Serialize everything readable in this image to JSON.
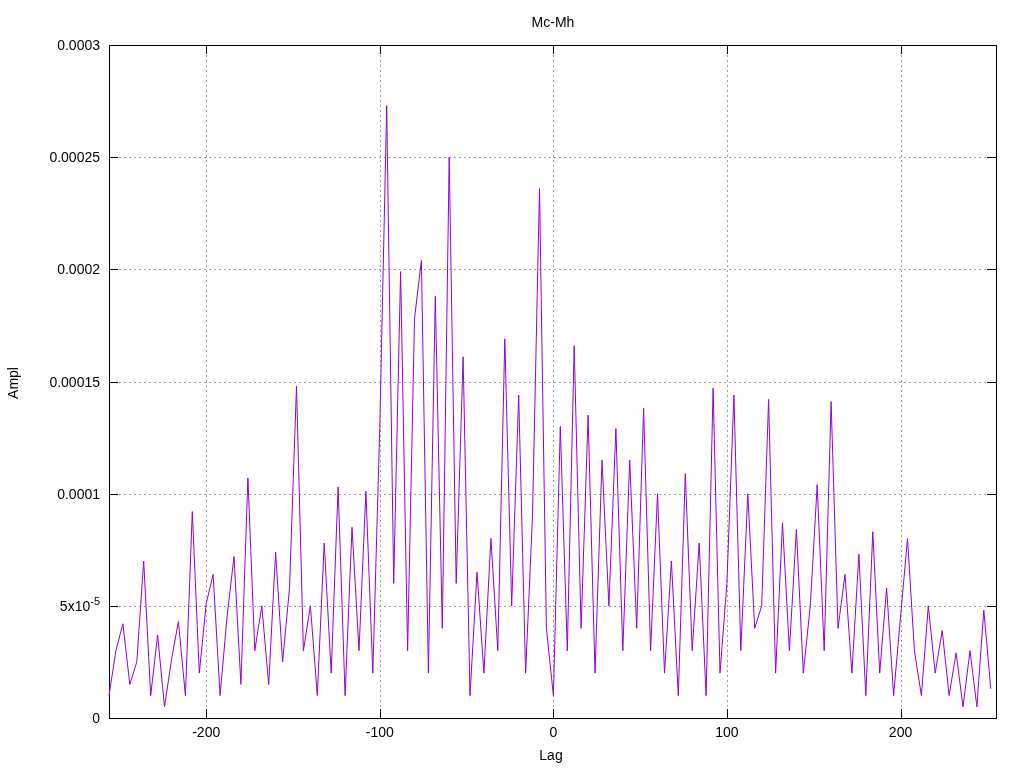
{
  "chart_data": {
    "type": "line",
    "grid": true,
    "title": "Mc-Mh",
    "xlabel": "Lag",
    "ylabel": "Ampl",
    "xlim": [
      -256,
      255
    ],
    "ylim": [
      0,
      0.0003
    ],
    "xticks": [
      -200,
      -100,
      0,
      100,
      200
    ],
    "yticks": [
      {
        "value": 0,
        "label": "0"
      },
      {
        "value": 5e-05,
        "label": "5x10$^{-5}$"
      },
      {
        "value": 0.0001,
        "label": "0.0001"
      },
      {
        "value": 0.00015,
        "label": "0.00015"
      },
      {
        "value": 0.0002,
        "label": "0.0002"
      },
      {
        "value": 0.00025,
        "label": "0.00025"
      },
      {
        "value": 0.0003,
        "label": "0.0003"
      }
    ],
    "x": [
      -256,
      -252,
      -248,
      -244,
      -240,
      -236,
      -232,
      -228,
      -224,
      -220,
      -216,
      -212,
      -208,
      -204,
      -200,
      -196,
      -192,
      -188,
      -184,
      -180,
      -176,
      -172,
      -168,
      -164,
      -160,
      -156,
      -152,
      -148,
      -144,
      -140,
      -136,
      -132,
      -128,
      -124,
      -120,
      -116,
      -112,
      -108,
      -104,
      -100,
      -96,
      -92,
      -88,
      -84,
      -80,
      -76,
      -72,
      -68,
      -64,
      -60,
      -56,
      -52,
      -48,
      -44,
      -40,
      -36,
      -32,
      -28,
      -24,
      -20,
      -16,
      -12,
      -8,
      -4,
      0,
      4,
      8,
      12,
      16,
      20,
      24,
      28,
      32,
      36,
      40,
      44,
      48,
      52,
      56,
      60,
      64,
      68,
      72,
      76,
      80,
      84,
      88,
      92,
      96,
      100,
      104,
      108,
      112,
      116,
      120,
      124,
      128,
      132,
      136,
      140,
      144,
      148,
      152,
      156,
      160,
      164,
      168,
      172,
      176,
      180,
      184,
      188,
      192,
      196,
      200,
      204,
      208,
      212,
      216,
      220,
      224,
      228,
      232,
      236,
      240,
      244,
      248,
      252
    ],
    "series": [
      {
        "color": "#9400d3",
        "values": [
          1e-05,
          3e-05,
          4.2e-05,
          1.5e-05,
          2.5e-05,
          7e-05,
          1e-05,
          3.7e-05,
          5e-06,
          2.6e-05,
          4.3e-05,
          1e-05,
          9.2e-05,
          2e-05,
          5.1e-05,
          6.4e-05,
          1e-05,
          4.5e-05,
          7.2e-05,
          1.5e-05,
          0.000107,
          3e-05,
          5e-05,
          1.5e-05,
          7.4e-05,
          2.5e-05,
          5.8e-05,
          0.000148,
          3e-05,
          5e-05,
          1e-05,
          7.8e-05,
          2e-05,
          0.000103,
          1e-05,
          8.5e-05,
          3e-05,
          0.000101,
          2e-05,
          0.00013,
          0.000273,
          6e-05,
          0.000199,
          3e-05,
          0.000178,
          0.000204,
          2e-05,
          0.000188,
          4e-05,
          0.00025,
          6e-05,
          0.000161,
          1e-05,
          6.5e-05,
          2e-05,
          8e-05,
          3e-05,
          0.000169,
          5e-05,
          0.000144,
          2e-05,
          9e-05,
          0.000236,
          4e-05,
          1e-05,
          0.00013,
          3e-05,
          0.000166,
          4e-05,
          0.000135,
          2e-05,
          0.000115,
          5e-05,
          0.000129,
          3e-05,
          0.000115,
          4e-05,
          0.000138,
          3e-05,
          0.0001,
          2e-05,
          7e-05,
          1e-05,
          0.000109,
          3e-05,
          7.8e-05,
          1e-05,
          0.000147,
          2e-05,
          6e-05,
          0.000144,
          3e-05,
          0.0001,
          4e-05,
          5e-05,
          0.000142,
          2e-05,
          8.7e-05,
          3e-05,
          8.4e-05,
          2e-05,
          5e-05,
          0.000104,
          3e-05,
          0.000141,
          4e-05,
          6.4e-05,
          2e-05,
          7.3e-05,
          1e-05,
          8.3e-05,
          2e-05,
          5.8e-05,
          1e-05,
          4.5e-05,
          8e-05,
          3e-05,
          1e-05,
          5e-05,
          2e-05,
          3.9e-05,
          1e-05,
          2.9e-05,
          5e-06,
          3e-05,
          5e-06,
          4.8e-05,
          1.3e-05
        ]
      }
    ]
  }
}
